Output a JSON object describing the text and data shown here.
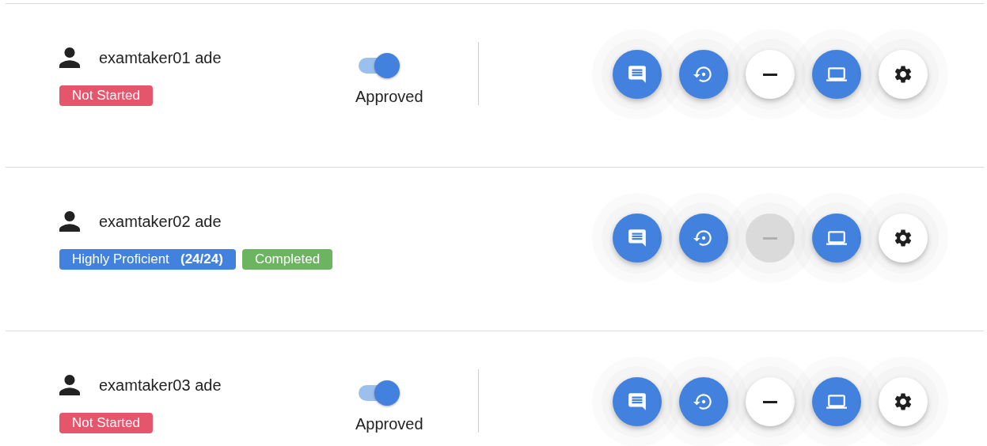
{
  "rows": [
    {
      "name": "examtaker01 ade",
      "badges": [
        {
          "text": "Not Started",
          "color": "#e5566d"
        }
      ],
      "approval": {
        "label": "Approved",
        "on": true
      },
      "buttons": [
        {
          "kind": "chat",
          "disabled": false
        },
        {
          "kind": "restore",
          "disabled": false
        },
        {
          "kind": "minus",
          "disabled": false
        },
        {
          "kind": "laptop",
          "disabled": false
        },
        {
          "kind": "settings",
          "disabled": false
        }
      ]
    },
    {
      "name": "examtaker02 ade",
      "badges": [
        {
          "text": "Highly Proficient   **(24/24)**",
          "color": "#4282de"
        },
        {
          "text": "Completed",
          "color": "#6db461"
        }
      ],
      "buttons": [
        {
          "kind": "chat",
          "disabled": false
        },
        {
          "kind": "restore",
          "disabled": false
        },
        {
          "kind": "minus",
          "disabled": true
        },
        {
          "kind": "laptop",
          "disabled": false
        },
        {
          "kind": "settings",
          "disabled": false
        }
      ]
    },
    {
      "name": "examtaker03 ade",
      "badges": [
        {
          "text": "Not Started",
          "color": "#e5566d"
        }
      ],
      "approval": {
        "label": "Approved",
        "on": true
      },
      "buttons": [
        {
          "kind": "chat",
          "disabled": false
        },
        {
          "kind": "restore",
          "disabled": false
        },
        {
          "kind": "minus",
          "disabled": false
        },
        {
          "kind": "laptop",
          "disabled": false
        },
        {
          "kind": "settings",
          "disabled": false
        }
      ]
    }
  ]
}
